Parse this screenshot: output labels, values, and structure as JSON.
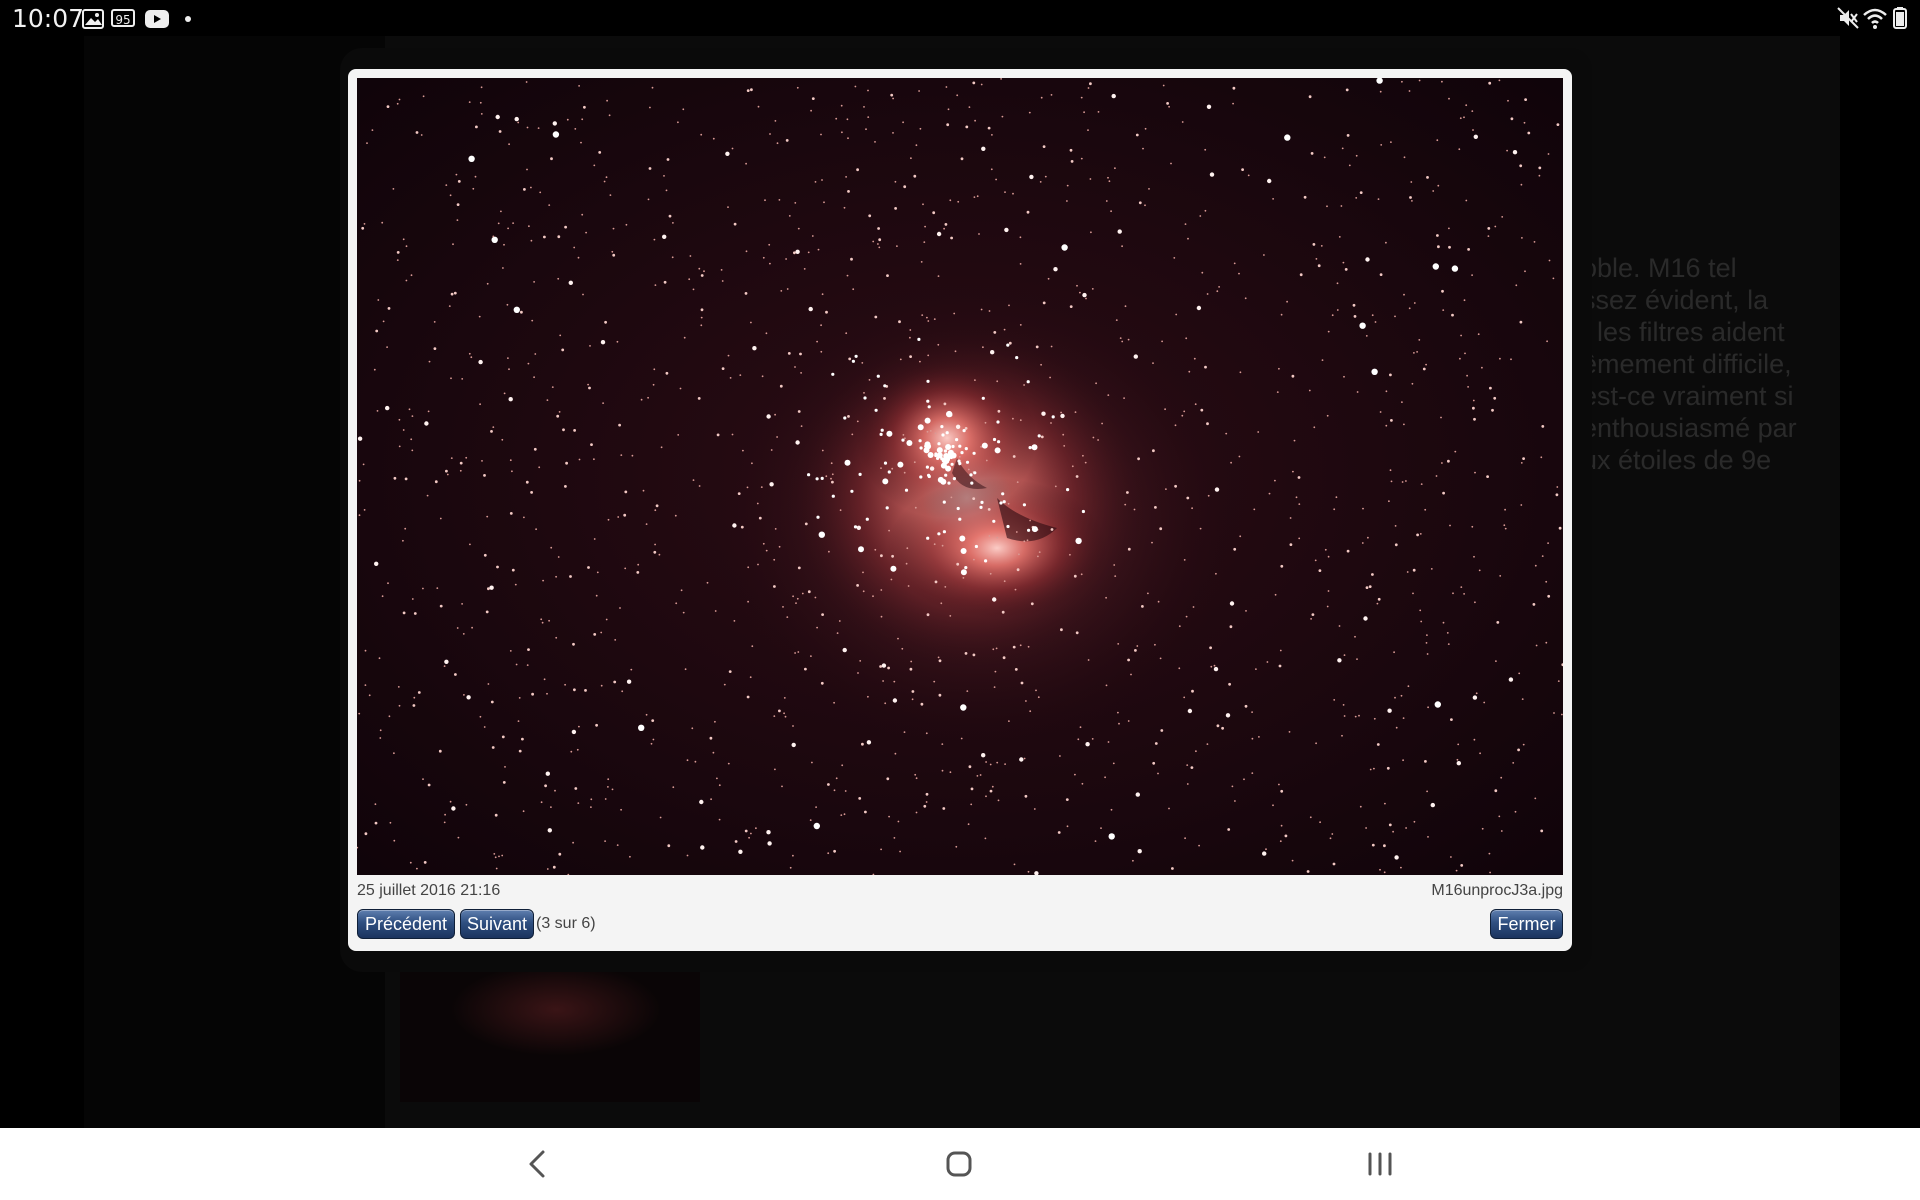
{
  "status_bar": {
    "time": "10:07",
    "icons_left": [
      "gallery-icon",
      "badge-95-icon",
      "youtube-icon",
      "dot-icon"
    ],
    "badge_text": "95",
    "icons_right": [
      "mute-icon",
      "wifi-icon",
      "battery-icon"
    ]
  },
  "background_page": {
    "text_lines": [
      "oble. M16 tel",
      "ssez évident, la",
      "t les filtres aident",
      "êmement difficile,",
      "est-ce vraiment si",
      " enthousiasmé par",
      "ux étoiles de 9e"
    ]
  },
  "lightbox": {
    "date": "25 juillet 2016 21:16",
    "filename": "M16unprocJ3a.jpg",
    "prev_label": "Précédent",
    "next_label": "Suivant",
    "counter": "(3 sur 6)",
    "close_label": "Fermer"
  },
  "nav_bar": {
    "icons": [
      "back-icon",
      "home-icon",
      "recents-icon"
    ]
  }
}
